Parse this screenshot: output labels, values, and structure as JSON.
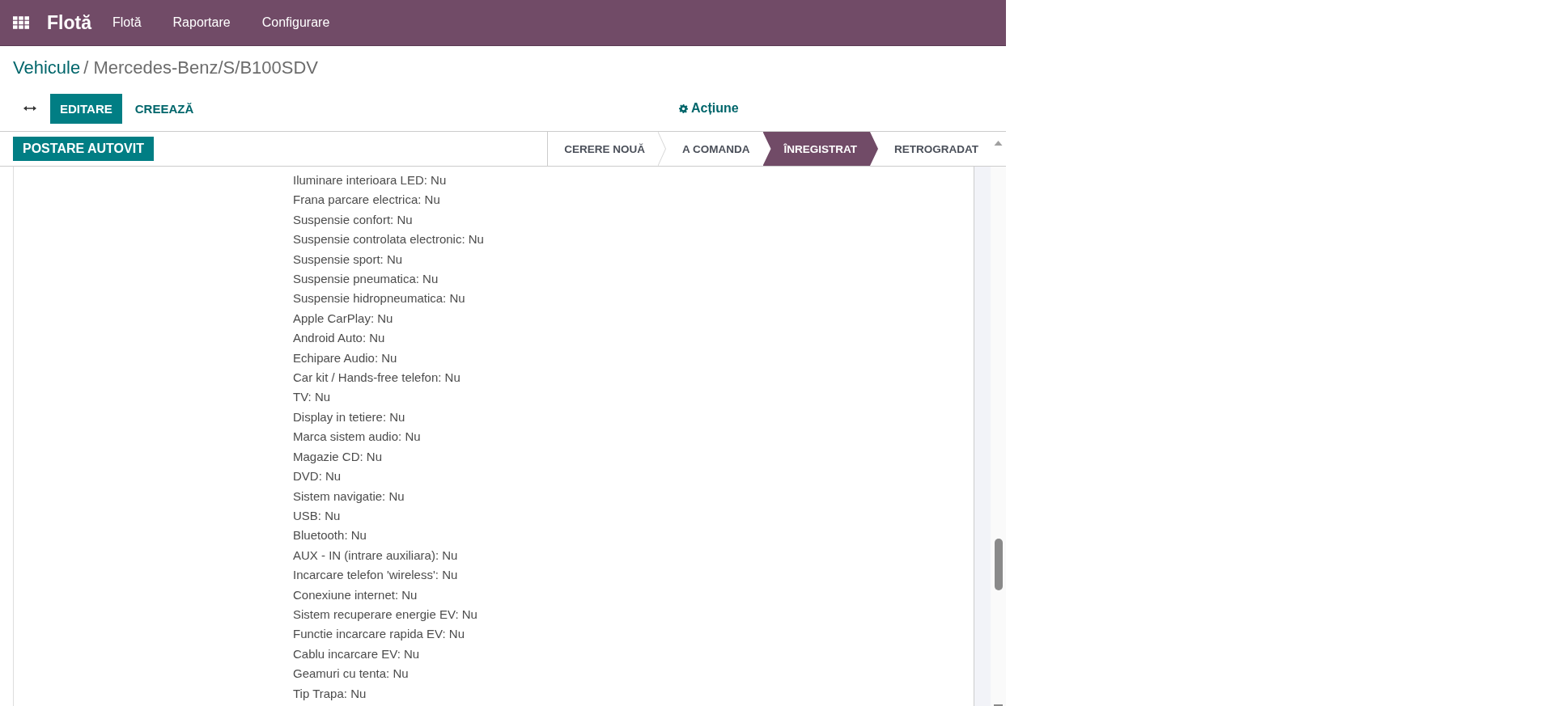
{
  "navbar": {
    "app_name": "Flotă",
    "menu": [
      {
        "label": "Flotă"
      },
      {
        "label": "Raportare"
      },
      {
        "label": "Configurare"
      }
    ]
  },
  "breadcrumb": {
    "parent": "Vehicule",
    "separator": "/",
    "current": "Mercedes-Benz/S/B100SDV"
  },
  "control_panel": {
    "edit_button": "EDITARE",
    "create_button": "CREEAZĂ",
    "action_menu": "Acțiune"
  },
  "status_bar": {
    "button": "POSTARE AUTOVIT",
    "stages": [
      {
        "label": "CERERE NOUĂ",
        "selected": false
      },
      {
        "label": "A COMANDA",
        "selected": false
      },
      {
        "label": "ÎNREGISTRAT",
        "selected": true
      },
      {
        "label": "RETROGRADAT",
        "selected": false
      }
    ]
  },
  "features": [
    "Iluminare interioara LED: Nu",
    "Frana parcare electrica: Nu",
    "Suspensie confort: Nu",
    "Suspensie controlata electronic: Nu",
    "Suspensie sport: Nu",
    "Suspensie pneumatica: Nu",
    "Suspensie hidropneumatica: Nu",
    "Apple CarPlay: Nu",
    "Android Auto: Nu",
    "Echipare Audio: Nu",
    "Car kit / Hands-free telefon: Nu",
    "TV: Nu",
    "Display in tetiere: Nu",
    "Marca sistem audio: Nu",
    "Magazie CD: Nu",
    "DVD: Nu",
    "Sistem navigatie: Nu",
    "USB: Nu",
    "Bluetooth: Nu",
    "AUX - IN (intrare auxiliara): Nu",
    "Incarcare telefon 'wireless': Nu",
    "Conexiune internet: Nu",
    "Sistem recuperare energie EV: Nu",
    "Functie incarcare rapida EV: Nu",
    "Cablu incarcare EV: Nu",
    "Geamuri cu tenta: Nu",
    "Tip Trapa: Nu"
  ]
}
